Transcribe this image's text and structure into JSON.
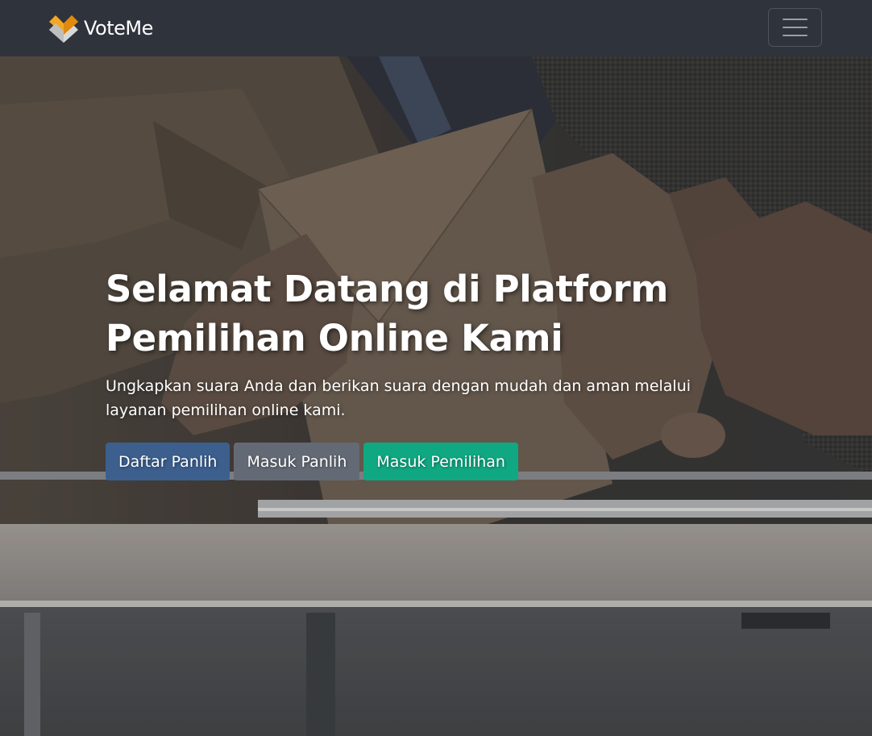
{
  "navbar": {
    "brand_name": "VoteMe",
    "logo_icon": "voteme-logo-icon",
    "toggle_icon": "hamburger-menu-icon",
    "background": "#2f333c"
  },
  "hero": {
    "background_image": "ballot-box-photo",
    "title": "Selamat Datang di Platform Pemilihan Online Kami",
    "subtitle": "Ungkapkan suara Anda dan berikan suara dengan mudah dan aman melalui layanan pemilihan online kami.",
    "buttons": [
      {
        "label": "Daftar Panlih",
        "color": "#3c5f8e"
      },
      {
        "label": "Masuk Panlih",
        "color": "#646a75"
      },
      {
        "label": "Masuk Pemilihan",
        "color": "#10a882"
      }
    ]
  }
}
